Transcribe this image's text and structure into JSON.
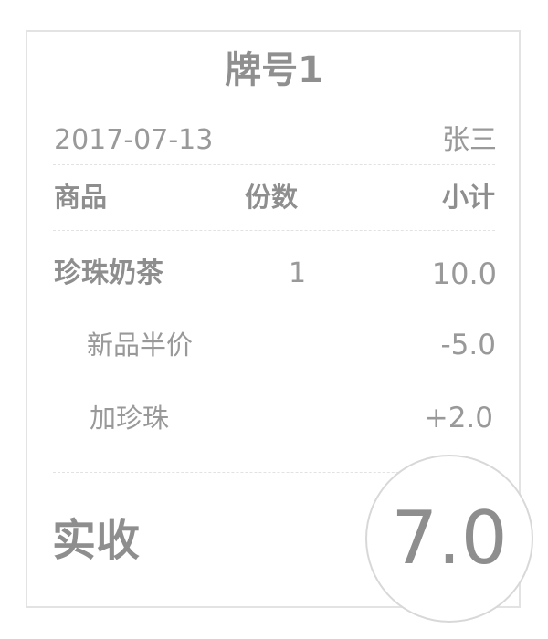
{
  "receipt": {
    "title": "牌号1",
    "date": "2017-07-13",
    "cashier": "张三",
    "headers": {
      "item": "商品",
      "qty": "份数",
      "subtotal": "小计"
    },
    "line_item": {
      "name": "珍珠奶茶",
      "qty": "1",
      "price": "10.0"
    },
    "modifiers": [
      {
        "name": "新品半价",
        "amount": "-5.0"
      },
      {
        "name": "加珍珠",
        "amount": "+2.0"
      }
    ],
    "total_label": "实收",
    "total_value": "7.0"
  },
  "colors": {
    "text": "#999999",
    "border": "#e3e3e3"
  }
}
